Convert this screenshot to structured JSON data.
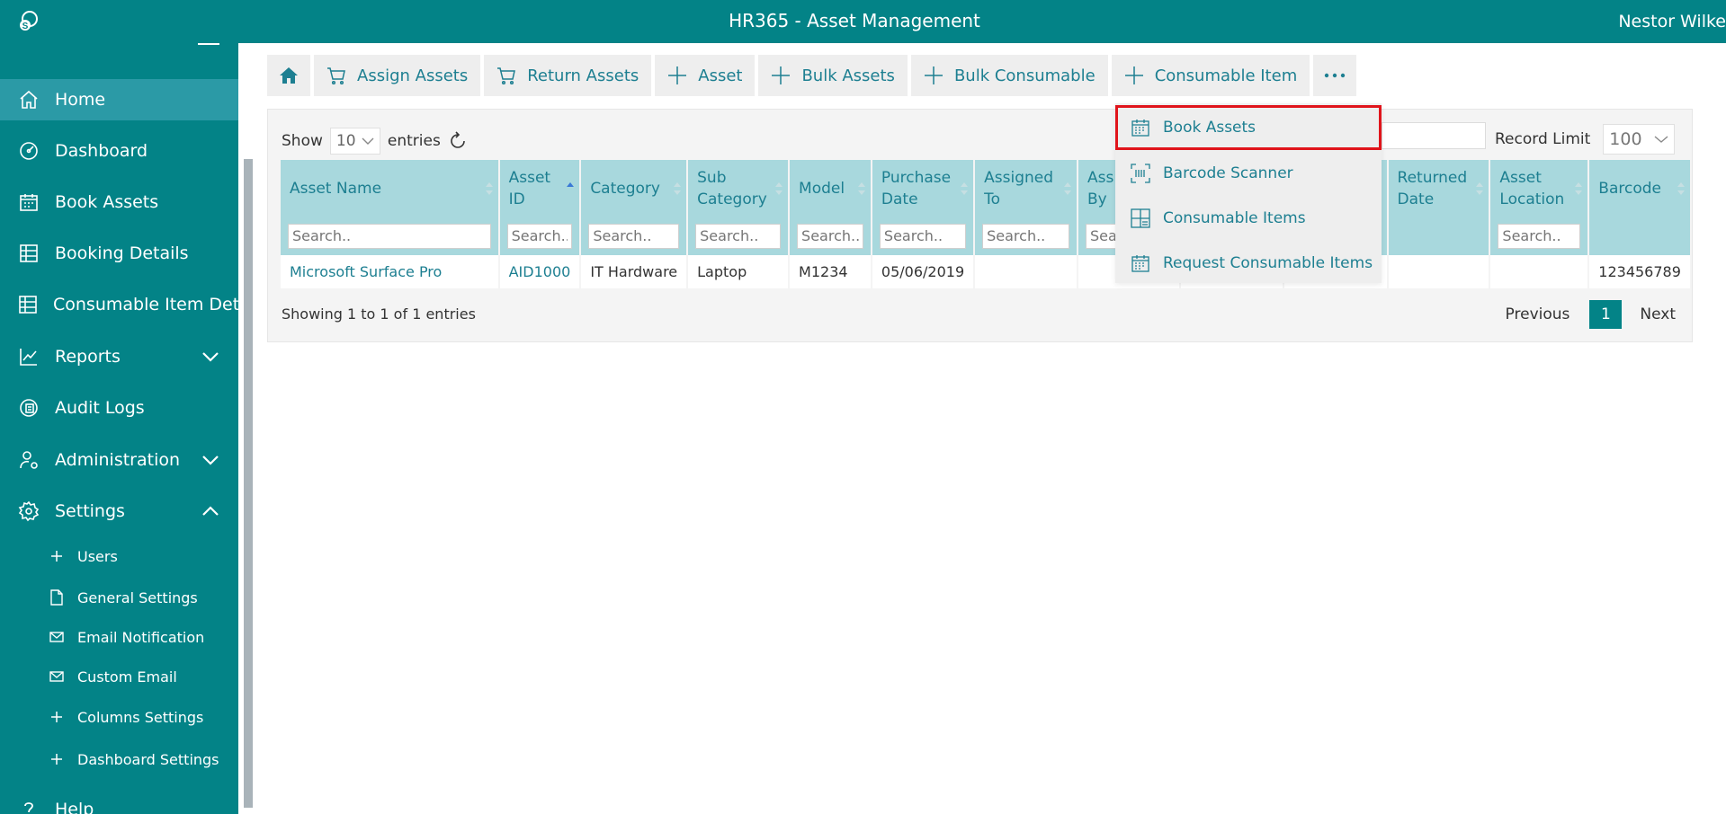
{
  "app": {
    "title": "HR365 - Asset Management",
    "user": "Nestor Wilke"
  },
  "sidebar": {
    "items": [
      {
        "label": "Home",
        "icon": "home-icon",
        "active": true
      },
      {
        "label": "Dashboard",
        "icon": "dashboard-gauge-icon"
      },
      {
        "label": "Book Assets",
        "icon": "calendar-icon"
      },
      {
        "label": "Booking Details",
        "icon": "table-icon"
      },
      {
        "label": "Consumable Item Details",
        "icon": "table-icon"
      },
      {
        "label": "Reports",
        "icon": "chart-line-icon",
        "chevron": "down"
      },
      {
        "label": "Audit Logs",
        "icon": "audit-icon"
      },
      {
        "label": "Administration",
        "icon": "user-settings-icon",
        "chevron": "down"
      },
      {
        "label": "Settings",
        "icon": "gear-icon",
        "chevron": "up"
      }
    ],
    "subitems": [
      {
        "label": "Users",
        "icon": "plus-icon"
      },
      {
        "label": "General Settings",
        "icon": "document-icon"
      },
      {
        "label": "Email Notification",
        "icon": "mail-icon"
      },
      {
        "label": "Custom Email",
        "icon": "mail-icon"
      },
      {
        "label": "Columns Settings",
        "icon": "plus-icon"
      },
      {
        "label": "Dashboard Settings",
        "icon": "plus-icon"
      }
    ],
    "help_label": "Help"
  },
  "toolbar": {
    "buttons": [
      {
        "label": "Assign Assets",
        "icon": "cart-icon"
      },
      {
        "label": "Return Assets",
        "icon": "cart-icon"
      },
      {
        "label": "Asset",
        "icon": "plus-icon"
      },
      {
        "label": "Bulk Assets",
        "icon": "plus-icon"
      },
      {
        "label": "Bulk Consumable",
        "icon": "plus-icon"
      },
      {
        "label": "Consumable Item",
        "icon": "plus-icon"
      }
    ],
    "more_icon": "more-dots-icon"
  },
  "table_controls": {
    "show_label": "Show",
    "entries_value": "10",
    "entries_label": "entries",
    "record_limit_label": "Record Limit",
    "record_limit_value": "100"
  },
  "table": {
    "columns": [
      {
        "label": "Asset Name",
        "placeholder": "Search.."
      },
      {
        "label": "Asset ID",
        "placeholder": "Search.."
      },
      {
        "label": "Category",
        "placeholder": "Search.."
      },
      {
        "label": "Sub Category",
        "placeholder": "Search.."
      },
      {
        "label": "Model",
        "placeholder": "Search.."
      },
      {
        "label": "Purchase Date",
        "placeholder": "Search.."
      },
      {
        "label": "Assigned To",
        "placeholder": "Search.."
      },
      {
        "label": "Assigned By",
        "placeholder": "Search.."
      },
      {
        "label": "",
        "placeholder": ""
      },
      {
        "label": "",
        "placeholder": ""
      },
      {
        "label": "Returned Date",
        "placeholder": ""
      },
      {
        "label": "Asset Location",
        "placeholder": "Search.."
      },
      {
        "label": "Barcode",
        "placeholder": ""
      }
    ],
    "rows": [
      [
        "Microsoft Surface Pro",
        "AID1000",
        "IT Hardware",
        "Laptop",
        "M1234",
        "05/06/2019",
        "",
        "",
        "",
        "",
        "",
        "",
        "123456789"
      ]
    ],
    "info": "Showing 1 to 1 of 1 entries",
    "pagination": {
      "previous": "Previous",
      "current": "1",
      "next": "Next"
    }
  },
  "more_menu": {
    "items": [
      {
        "label": "Book Assets",
        "icon": "calendar-icon",
        "highlighted": true
      },
      {
        "label": "Barcode Scanner",
        "icon": "barcode-scanner-icon"
      },
      {
        "label": "Consumable Items",
        "icon": "grid-list-icon"
      },
      {
        "label": "Request Consumable Items",
        "icon": "calendar-icon"
      }
    ]
  },
  "colors": {
    "brand": "#038387",
    "header_cell": "#a8d8dd",
    "link": "#1d7f91",
    "highlight": "#e0141b"
  }
}
